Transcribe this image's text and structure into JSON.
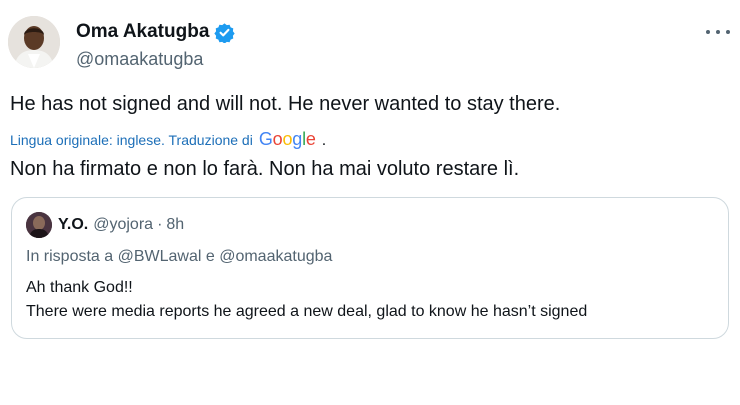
{
  "author": {
    "display_name": "Oma Akatugba",
    "handle": "@omaakatugba",
    "verified": true
  },
  "icons": {
    "verified": "verified-badge-icon",
    "more": "more-options-icon"
  },
  "tweet": {
    "text": "He has not signed and will not. He never wanted to stay there.",
    "translation_note": "Lingua originale: inglese. Traduzione di",
    "translation_provider_letters": [
      "G",
      "o",
      "o",
      "g",
      "l",
      "e"
    ],
    "translation_suffix": ".",
    "translated_text": "Non ha firmato e non lo farà. Non ha mai voluto restare lì."
  },
  "quoted_tweet": {
    "display_name": "Y.O.",
    "handle": "@yojora",
    "separator": "·",
    "time": "8h",
    "reply_context": "In risposta a @BWLawal e @omaakatugba",
    "line1": "Ah thank God!!",
    "line2": "There were media reports he agreed a new deal, glad to know he hasn’t signed"
  },
  "colors": {
    "verified_blue": "#1d9bf0",
    "link_blue": "#1d6fb8",
    "secondary_text": "#536471",
    "border": "#cfd9de"
  }
}
